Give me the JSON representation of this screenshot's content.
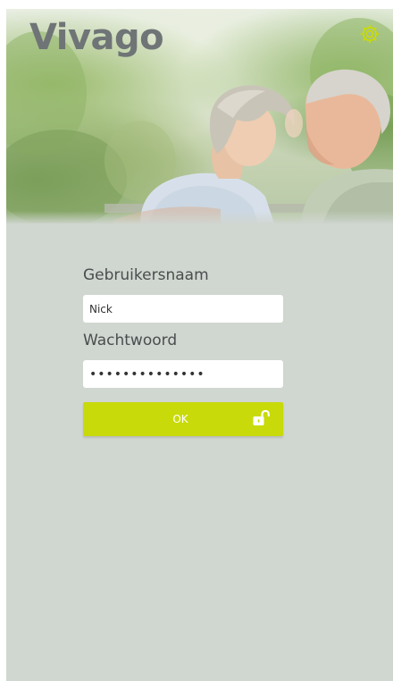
{
  "app": {
    "brand_name": "Vivago",
    "colors": {
      "accent": "#c8da0a",
      "background": "#d0d6d0",
      "logo": "#6f7476",
      "label_text": "#4a4d4e"
    }
  },
  "header": {
    "settings_icon": "gear-icon",
    "photo": "elderly-couple-photo"
  },
  "login": {
    "username_label": "Gebruikersnaam",
    "username_value": "Nick",
    "password_label": "Wachtwoord",
    "password_value": "••••••••••••••",
    "submit_label": "OK",
    "submit_icon": "unlock-icon"
  }
}
